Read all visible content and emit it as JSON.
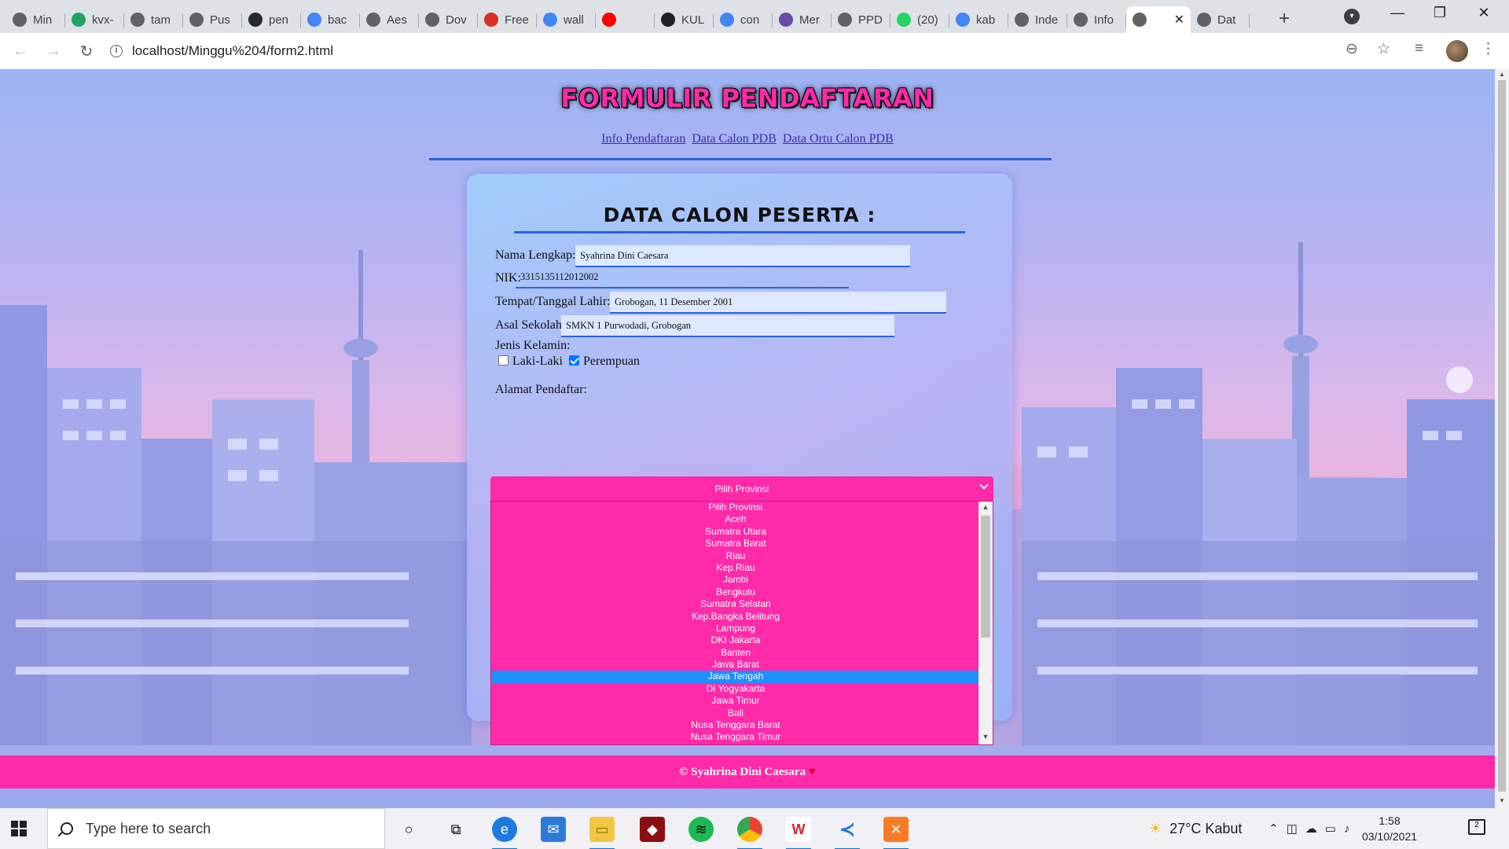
{
  "browser": {
    "tabs": [
      {
        "title": "Min",
        "icon": "globe-icon",
        "color": "#5f6368"
      },
      {
        "title": "kvx-",
        "icon": "google-drive-icon",
        "color": "#1fa463"
      },
      {
        "title": "tam",
        "icon": "globe-icon",
        "color": "#5f6368"
      },
      {
        "title": "Pus",
        "icon": "globe-icon",
        "color": "#5f6368"
      },
      {
        "title": "pen",
        "icon": "github-icon",
        "color": "#24292e"
      },
      {
        "title": "bac",
        "icon": "google-icon",
        "color": "#4285f4"
      },
      {
        "title": "Aes",
        "icon": "globe-icon",
        "color": "#5f6368"
      },
      {
        "title": "Dov",
        "icon": "globe-icon",
        "color": "#5f6368"
      },
      {
        "title": "Free",
        "icon": "freepik-icon",
        "color": "#d93025"
      },
      {
        "title": "wall",
        "icon": "google-icon",
        "color": "#4285f4"
      },
      {
        "title": "",
        "icon": "youtube-icon",
        "color": "#ff0000"
      },
      {
        "title": "KUL",
        "icon": "m-icon",
        "color": "#202124"
      },
      {
        "title": "con",
        "icon": "google-icon",
        "color": "#4285f4"
      },
      {
        "title": "Mer",
        "icon": "image-icon",
        "color": "#6a4aa8"
      },
      {
        "title": "PPD",
        "icon": "globe-icon",
        "color": "#5f6368"
      },
      {
        "title": "(20)",
        "icon": "badge-icon",
        "color": "#25d366"
      },
      {
        "title": "kab",
        "icon": "google-icon",
        "color": "#4285f4"
      },
      {
        "title": "Inde",
        "icon": "globe-icon",
        "color": "#5f6368"
      },
      {
        "title": "Info",
        "icon": "globe-icon",
        "color": "#5f6368"
      },
      {
        "title": "",
        "icon": "globe-icon",
        "color": "#5f6368",
        "active": true
      },
      {
        "title": "Dat",
        "icon": "globe-icon",
        "color": "#5f6368"
      }
    ],
    "url": "localhost/Minggu%204/form2.html"
  },
  "page": {
    "title": "FORMULIR PENDAFTARAN",
    "nav": [
      "Info Pendaftaran",
      "Data Calon PDB",
      "Data Ortu Calon PDB"
    ],
    "card_title": "DATA CALON PESERTA :",
    "fields": {
      "nama_label": "Nama Lengkap:",
      "nama_value": "Syahrina Dini Caesara",
      "nik_label": "NIK:",
      "nik_value": "3315135112012002",
      "ttl_label": "Tempat/Tanggal Lahir:",
      "ttl_value": "Grobogan, 11 Desember 2001",
      "sekolah_label": "Asal Sekolah:",
      "sekolah_value": "SMKN 1 Purwodadi, Grobogan",
      "jk_label": "Jenis Kelamin:",
      "jk_options": [
        {
          "label": "Laki-Laki",
          "checked": false
        },
        {
          "label": "Perempuan",
          "checked": true
        }
      ],
      "alamat_label": "Alamat Pendaftar:"
    },
    "province_select": {
      "selected": "Pilih Provinsi",
      "highlighted": "Jawa Tengah",
      "options": [
        "Pilih Provinsi",
        "Aceh",
        "Sumatra Utara",
        "Sumatra Barat",
        "Riau",
        "Kep.Riau",
        "Jambi",
        "Bengkulu",
        "Sumatra Selatan",
        "Kep.Bangka Belitung",
        "Lampung",
        "DKI Jakarta",
        "Banten",
        "Jawa Barat",
        "Jawa Tengah",
        "DI Yogyakarta",
        "Jawa Timur",
        "Bali",
        "Nusa Tenggara Barat",
        "Nusa Tenggara Timur"
      ]
    },
    "footer": "© Syahrina Dini Caesara",
    "accent": "#ff2aa8",
    "link_color": "#3a2ea8",
    "rule_color": "#2a63d9"
  },
  "taskbar": {
    "search_placeholder": "Type here to search",
    "weather": "27°C  Kabut",
    "time": "1:58",
    "date": "03/10/2021",
    "notifications": "2"
  }
}
